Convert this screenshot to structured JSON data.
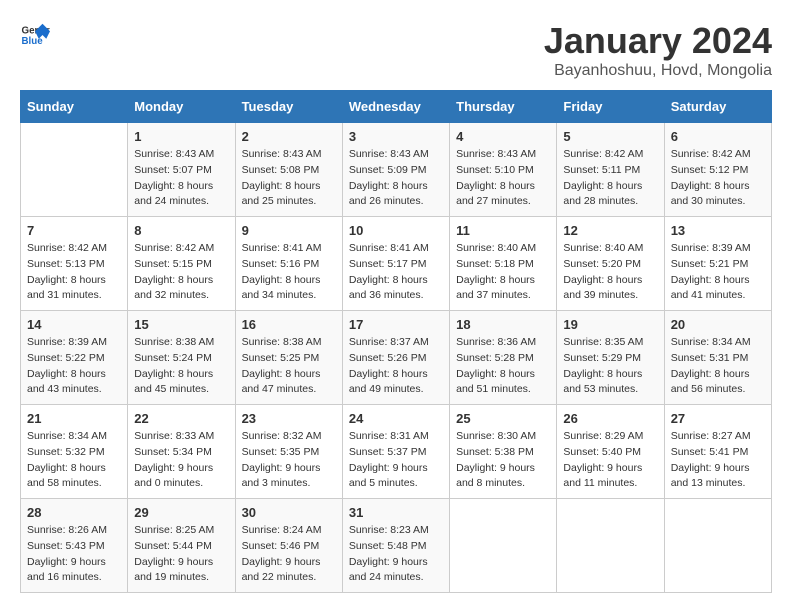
{
  "header": {
    "logo_general": "General",
    "logo_blue": "Blue",
    "title": "January 2024",
    "location": "Bayanhoshuu, Hovd, Mongolia"
  },
  "days_of_week": [
    "Sunday",
    "Monday",
    "Tuesday",
    "Wednesday",
    "Thursday",
    "Friday",
    "Saturday"
  ],
  "weeks": [
    [
      {
        "day": "",
        "sunrise": "",
        "sunset": "",
        "daylight": ""
      },
      {
        "day": "1",
        "sunrise": "Sunrise: 8:43 AM",
        "sunset": "Sunset: 5:07 PM",
        "daylight": "Daylight: 8 hours and 24 minutes."
      },
      {
        "day": "2",
        "sunrise": "Sunrise: 8:43 AM",
        "sunset": "Sunset: 5:08 PM",
        "daylight": "Daylight: 8 hours and 25 minutes."
      },
      {
        "day": "3",
        "sunrise": "Sunrise: 8:43 AM",
        "sunset": "Sunset: 5:09 PM",
        "daylight": "Daylight: 8 hours and 26 minutes."
      },
      {
        "day": "4",
        "sunrise": "Sunrise: 8:43 AM",
        "sunset": "Sunset: 5:10 PM",
        "daylight": "Daylight: 8 hours and 27 minutes."
      },
      {
        "day": "5",
        "sunrise": "Sunrise: 8:42 AM",
        "sunset": "Sunset: 5:11 PM",
        "daylight": "Daylight: 8 hours and 28 minutes."
      },
      {
        "day": "6",
        "sunrise": "Sunrise: 8:42 AM",
        "sunset": "Sunset: 5:12 PM",
        "daylight": "Daylight: 8 hours and 30 minutes."
      }
    ],
    [
      {
        "day": "7",
        "sunrise": "Sunrise: 8:42 AM",
        "sunset": "Sunset: 5:13 PM",
        "daylight": "Daylight: 8 hours and 31 minutes."
      },
      {
        "day": "8",
        "sunrise": "Sunrise: 8:42 AM",
        "sunset": "Sunset: 5:15 PM",
        "daylight": "Daylight: 8 hours and 32 minutes."
      },
      {
        "day": "9",
        "sunrise": "Sunrise: 8:41 AM",
        "sunset": "Sunset: 5:16 PM",
        "daylight": "Daylight: 8 hours and 34 minutes."
      },
      {
        "day": "10",
        "sunrise": "Sunrise: 8:41 AM",
        "sunset": "Sunset: 5:17 PM",
        "daylight": "Daylight: 8 hours and 36 minutes."
      },
      {
        "day": "11",
        "sunrise": "Sunrise: 8:40 AM",
        "sunset": "Sunset: 5:18 PM",
        "daylight": "Daylight: 8 hours and 37 minutes."
      },
      {
        "day": "12",
        "sunrise": "Sunrise: 8:40 AM",
        "sunset": "Sunset: 5:20 PM",
        "daylight": "Daylight: 8 hours and 39 minutes."
      },
      {
        "day": "13",
        "sunrise": "Sunrise: 8:39 AM",
        "sunset": "Sunset: 5:21 PM",
        "daylight": "Daylight: 8 hours and 41 minutes."
      }
    ],
    [
      {
        "day": "14",
        "sunrise": "Sunrise: 8:39 AM",
        "sunset": "Sunset: 5:22 PM",
        "daylight": "Daylight: 8 hours and 43 minutes."
      },
      {
        "day": "15",
        "sunrise": "Sunrise: 8:38 AM",
        "sunset": "Sunset: 5:24 PM",
        "daylight": "Daylight: 8 hours and 45 minutes."
      },
      {
        "day": "16",
        "sunrise": "Sunrise: 8:38 AM",
        "sunset": "Sunset: 5:25 PM",
        "daylight": "Daylight: 8 hours and 47 minutes."
      },
      {
        "day": "17",
        "sunrise": "Sunrise: 8:37 AM",
        "sunset": "Sunset: 5:26 PM",
        "daylight": "Daylight: 8 hours and 49 minutes."
      },
      {
        "day": "18",
        "sunrise": "Sunrise: 8:36 AM",
        "sunset": "Sunset: 5:28 PM",
        "daylight": "Daylight: 8 hours and 51 minutes."
      },
      {
        "day": "19",
        "sunrise": "Sunrise: 8:35 AM",
        "sunset": "Sunset: 5:29 PM",
        "daylight": "Daylight: 8 hours and 53 minutes."
      },
      {
        "day": "20",
        "sunrise": "Sunrise: 8:34 AM",
        "sunset": "Sunset: 5:31 PM",
        "daylight": "Daylight: 8 hours and 56 minutes."
      }
    ],
    [
      {
        "day": "21",
        "sunrise": "Sunrise: 8:34 AM",
        "sunset": "Sunset: 5:32 PM",
        "daylight": "Daylight: 8 hours and 58 minutes."
      },
      {
        "day": "22",
        "sunrise": "Sunrise: 8:33 AM",
        "sunset": "Sunset: 5:34 PM",
        "daylight": "Daylight: 9 hours and 0 minutes."
      },
      {
        "day": "23",
        "sunrise": "Sunrise: 8:32 AM",
        "sunset": "Sunset: 5:35 PM",
        "daylight": "Daylight: 9 hours and 3 minutes."
      },
      {
        "day": "24",
        "sunrise": "Sunrise: 8:31 AM",
        "sunset": "Sunset: 5:37 PM",
        "daylight": "Daylight: 9 hours and 5 minutes."
      },
      {
        "day": "25",
        "sunrise": "Sunrise: 8:30 AM",
        "sunset": "Sunset: 5:38 PM",
        "daylight": "Daylight: 9 hours and 8 minutes."
      },
      {
        "day": "26",
        "sunrise": "Sunrise: 8:29 AM",
        "sunset": "Sunset: 5:40 PM",
        "daylight": "Daylight: 9 hours and 11 minutes."
      },
      {
        "day": "27",
        "sunrise": "Sunrise: 8:27 AM",
        "sunset": "Sunset: 5:41 PM",
        "daylight": "Daylight: 9 hours and 13 minutes."
      }
    ],
    [
      {
        "day": "28",
        "sunrise": "Sunrise: 8:26 AM",
        "sunset": "Sunset: 5:43 PM",
        "daylight": "Daylight: 9 hours and 16 minutes."
      },
      {
        "day": "29",
        "sunrise": "Sunrise: 8:25 AM",
        "sunset": "Sunset: 5:44 PM",
        "daylight": "Daylight: 9 hours and 19 minutes."
      },
      {
        "day": "30",
        "sunrise": "Sunrise: 8:24 AM",
        "sunset": "Sunset: 5:46 PM",
        "daylight": "Daylight: 9 hours and 22 minutes."
      },
      {
        "day": "31",
        "sunrise": "Sunrise: 8:23 AM",
        "sunset": "Sunset: 5:48 PM",
        "daylight": "Daylight: 9 hours and 24 minutes."
      },
      {
        "day": "",
        "sunrise": "",
        "sunset": "",
        "daylight": ""
      },
      {
        "day": "",
        "sunrise": "",
        "sunset": "",
        "daylight": ""
      },
      {
        "day": "",
        "sunrise": "",
        "sunset": "",
        "daylight": ""
      }
    ]
  ]
}
